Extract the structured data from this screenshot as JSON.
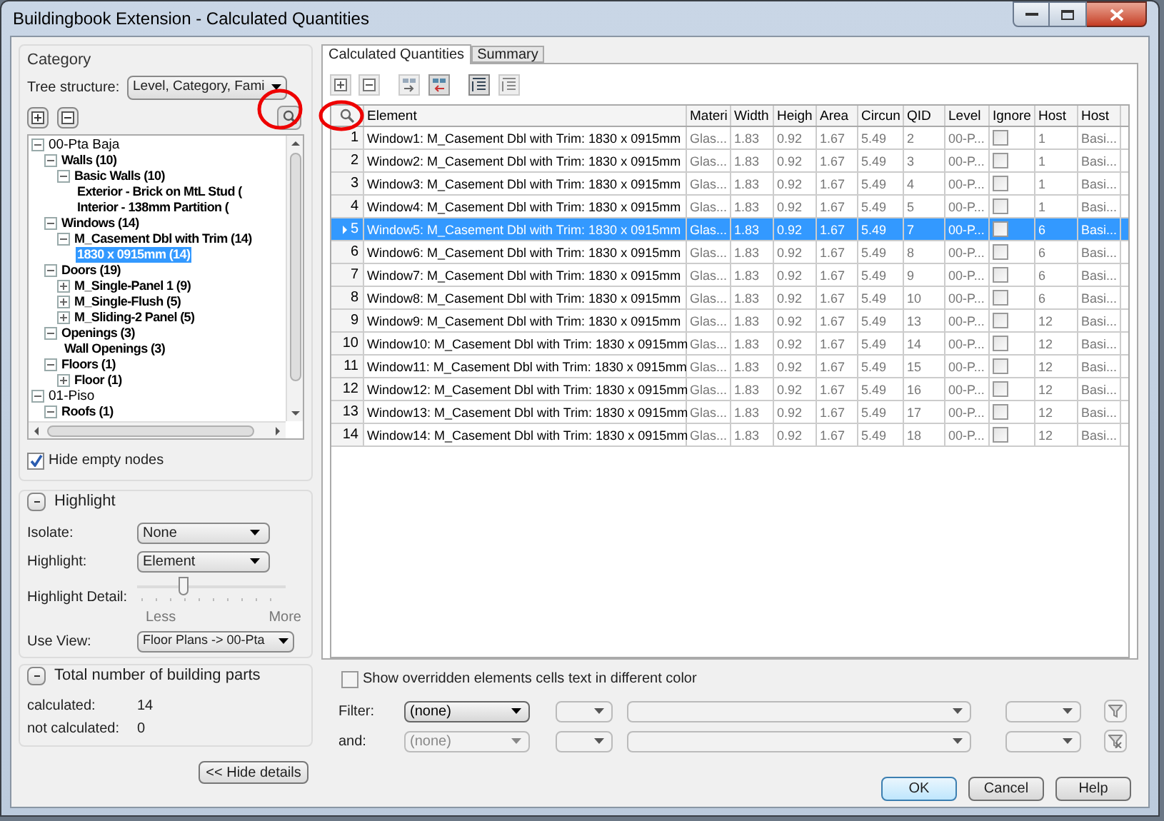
{
  "window": {
    "title": "Buildingbook Extension - Calculated Quantities"
  },
  "category": {
    "title": "Category",
    "tree_structure_label": "Tree structure:",
    "tree_structure_value": "Level, Category, Fami",
    "tree": [
      {
        "label": "00-Pta Baja",
        "expanded": true,
        "selected": false,
        "children": [
          {
            "label": "Walls (10)",
            "expanded": true,
            "selected": false,
            "children": [
              {
                "label": "Basic Walls (10)",
                "expanded": true,
                "selected": false,
                "children": [
                  {
                    "label": "Exterior - Brick on MtL Stud (",
                    "selected": false
                  },
                  {
                    "label": "Interior - 138mm Partition (",
                    "selected": false
                  }
                ]
              }
            ]
          },
          {
            "label": "Windows (14)",
            "expanded": true,
            "selected": false,
            "children": [
              {
                "label": "M_Casement Dbl with Trim (14)",
                "expanded": true,
                "selected": false,
                "children": [
                  {
                    "label": "1830 x 0915mm (14)",
                    "selected": true
                  }
                ]
              }
            ]
          },
          {
            "label": "Doors (19)",
            "expanded": true,
            "selected": false,
            "children": [
              {
                "label": "M_Single-Panel 1 (9)",
                "expanded": false,
                "selected": false
              },
              {
                "label": "M_Single-Flush (5)",
                "expanded": false,
                "selected": false
              },
              {
                "label": "M_Sliding-2 Panel (5)",
                "expanded": false,
                "selected": false
              }
            ]
          },
          {
            "label": "Openings (3)",
            "expanded": true,
            "selected": false,
            "children": [
              {
                "label": "Wall Openings (3)",
                "selected": false
              }
            ]
          },
          {
            "label": "Floors (1)",
            "expanded": true,
            "selected": false,
            "children": [
              {
                "label": "Floor (1)",
                "expanded": false,
                "selected": false
              }
            ]
          }
        ]
      },
      {
        "label": "01-Piso",
        "expanded": true,
        "selected": false,
        "children": [
          {
            "label": "Roofs (1)",
            "expanded": true,
            "selected": false
          }
        ]
      }
    ],
    "hide_empty_nodes": {
      "label": "Hide empty nodes",
      "checked": true
    }
  },
  "highlight": {
    "title": "Highlight",
    "isolate_label": "Isolate:",
    "isolate_value": "None",
    "highlight_label": "Highlight:",
    "highlight_value": "Element",
    "detail_label": "Highlight Detail:",
    "detail": {
      "level": 0.3
    },
    "less": "Less",
    "more": "More",
    "use_view_label": "Use View:",
    "use_view_value": "Floor Plans -> 00-Pta"
  },
  "totals": {
    "title": "Total number of building parts",
    "rows": [
      {
        "label": "calculated:",
        "value": "14"
      },
      {
        "label": "not calculated:",
        "value": "0"
      }
    ]
  },
  "hide_details_button": "<< Hide details",
  "tabs": [
    {
      "label": "Calculated Quantities",
      "selected": true
    },
    {
      "label": "Summary",
      "selected": false
    }
  ],
  "table": {
    "columns": [
      "Element",
      "Materi",
      "Width",
      "Heigh",
      "Area",
      "Circun",
      "QID",
      "Level",
      "Ignore",
      "Host",
      "Host"
    ],
    "rows": [
      {
        "number": "1",
        "cells": [
          "Window1: M_Casement Dbl with Trim: 1830 x 0915mm",
          "Glas...",
          "1.83",
          "0.92",
          "1.67",
          "5.49",
          "2",
          "00-P..."
        ],
        "ignore": false,
        "host_cells": [
          "1",
          "Basi..."
        ],
        "selected": false
      },
      {
        "number": "2",
        "cells": [
          "Window2: M_Casement Dbl with Trim: 1830 x 0915mm",
          "Glas...",
          "1.83",
          "0.92",
          "1.67",
          "5.49",
          "3",
          "00-P..."
        ],
        "ignore": false,
        "host_cells": [
          "1",
          "Basi..."
        ],
        "selected": false
      },
      {
        "number": "3",
        "cells": [
          "Window3: M_Casement Dbl with Trim: 1830 x 0915mm",
          "Glas...",
          "1.83",
          "0.92",
          "1.67",
          "5.49",
          "4",
          "00-P..."
        ],
        "ignore": false,
        "host_cells": [
          "1",
          "Basi..."
        ],
        "selected": false
      },
      {
        "number": "4",
        "cells": [
          "Window4: M_Casement Dbl with Trim: 1830 x 0915mm",
          "Glas...",
          "1.83",
          "0.92",
          "1.67",
          "5.49",
          "5",
          "00-P..."
        ],
        "ignore": false,
        "host_cells": [
          "1",
          "Basi..."
        ],
        "selected": false
      },
      {
        "number": "5",
        "cells": [
          "Window5: M_Casement Dbl with Trim: 1830 x 0915mm",
          "Glas...",
          "1.83",
          "0.92",
          "1.67",
          "5.49",
          "7",
          "00-P..."
        ],
        "ignore": false,
        "host_cells": [
          "6",
          "Basi..."
        ],
        "selected": true
      },
      {
        "number": "6",
        "cells": [
          "Window6: M_Casement Dbl with Trim: 1830 x 0915mm",
          "Glas...",
          "1.83",
          "0.92",
          "1.67",
          "5.49",
          "8",
          "00-P..."
        ],
        "ignore": false,
        "host_cells": [
          "6",
          "Basi..."
        ],
        "selected": false
      },
      {
        "number": "7",
        "cells": [
          "Window7: M_Casement Dbl with Trim: 1830 x 0915mm",
          "Glas...",
          "1.83",
          "0.92",
          "1.67",
          "5.49",
          "9",
          "00-P..."
        ],
        "ignore": false,
        "host_cells": [
          "6",
          "Basi..."
        ],
        "selected": false
      },
      {
        "number": "8",
        "cells": [
          "Window8: M_Casement Dbl with Trim: 1830 x 0915mm",
          "Glas...",
          "1.83",
          "0.92",
          "1.67",
          "5.49",
          "10",
          "00-P..."
        ],
        "ignore": false,
        "host_cells": [
          "6",
          "Basi..."
        ],
        "selected": false
      },
      {
        "number": "9",
        "cells": [
          "Window9: M_Casement Dbl with Trim: 1830 x 0915mm",
          "Glas...",
          "1.83",
          "0.92",
          "1.67",
          "5.49",
          "13",
          "00-P..."
        ],
        "ignore": false,
        "host_cells": [
          "12",
          "Basi..."
        ],
        "selected": false
      },
      {
        "number": "10",
        "cells": [
          "Window10: M_Casement Dbl with Trim: 1830 x 0915mm",
          "Glas...",
          "1.83",
          "0.92",
          "1.67",
          "5.49",
          "14",
          "00-P..."
        ],
        "ignore": false,
        "host_cells": [
          "12",
          "Basi..."
        ],
        "selected": false
      },
      {
        "number": "11",
        "cells": [
          "Window11: M_Casement Dbl with Trim: 1830 x 0915mm",
          "Glas...",
          "1.83",
          "0.92",
          "1.67",
          "5.49",
          "15",
          "00-P..."
        ],
        "ignore": false,
        "host_cells": [
          "12",
          "Basi..."
        ],
        "selected": false
      },
      {
        "number": "12",
        "cells": [
          "Window12: M_Casement Dbl with Trim: 1830 x 0915mm",
          "Glas...",
          "1.83",
          "0.92",
          "1.67",
          "5.49",
          "16",
          "00-P..."
        ],
        "ignore": false,
        "host_cells": [
          "12",
          "Basi..."
        ],
        "selected": false
      },
      {
        "number": "13",
        "cells": [
          "Window13: M_Casement Dbl with Trim: 1830 x 0915mm",
          "Glas...",
          "1.83",
          "0.92",
          "1.67",
          "5.49",
          "17",
          "00-P..."
        ],
        "ignore": false,
        "host_cells": [
          "12",
          "Basi..."
        ],
        "selected": false
      },
      {
        "number": "14",
        "cells": [
          "Window14: M_Casement Dbl with Trim: 1830 x 0915mm",
          "Glas...",
          "1.83",
          "0.92",
          "1.67",
          "5.49",
          "18",
          "00-P..."
        ],
        "ignore": false,
        "host_cells": [
          "12",
          "Basi..."
        ],
        "selected": false
      }
    ]
  },
  "show_overridden": {
    "label": "Show overridden elements cells text in different color",
    "checked": false
  },
  "filters": [
    {
      "label": "Filter:",
      "value": "(none)",
      "disabled": false
    },
    {
      "label": "and:",
      "value": "(none)",
      "disabled": true
    }
  ],
  "buttons": [
    {
      "label": "OK",
      "default": true
    },
    {
      "label": "Cancel",
      "default": false
    },
    {
      "label": "Help",
      "default": false
    }
  ]
}
